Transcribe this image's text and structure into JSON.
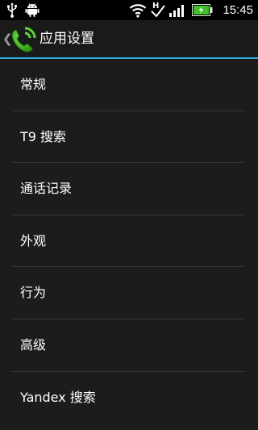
{
  "status_bar": {
    "time": "15:45",
    "network_type": "H",
    "icons": [
      "usb-icon",
      "android-debug-icon",
      "wifi-icon",
      "network-h-icon",
      "signal-icon",
      "battery-charging-icon"
    ],
    "battery_color": "#3fbf2a"
  },
  "header": {
    "title": "应用设置",
    "back_icon": "chevron-left-icon",
    "app_icon": "phone-icon",
    "accent_color": "#2aa9d6"
  },
  "settings": {
    "items": [
      {
        "label": "常规"
      },
      {
        "label": "T9 搜索"
      },
      {
        "label": "通话记录"
      },
      {
        "label": "外观"
      },
      {
        "label": "行为"
      },
      {
        "label": "高级"
      },
      {
        "label": "Yandex 搜索"
      }
    ]
  }
}
